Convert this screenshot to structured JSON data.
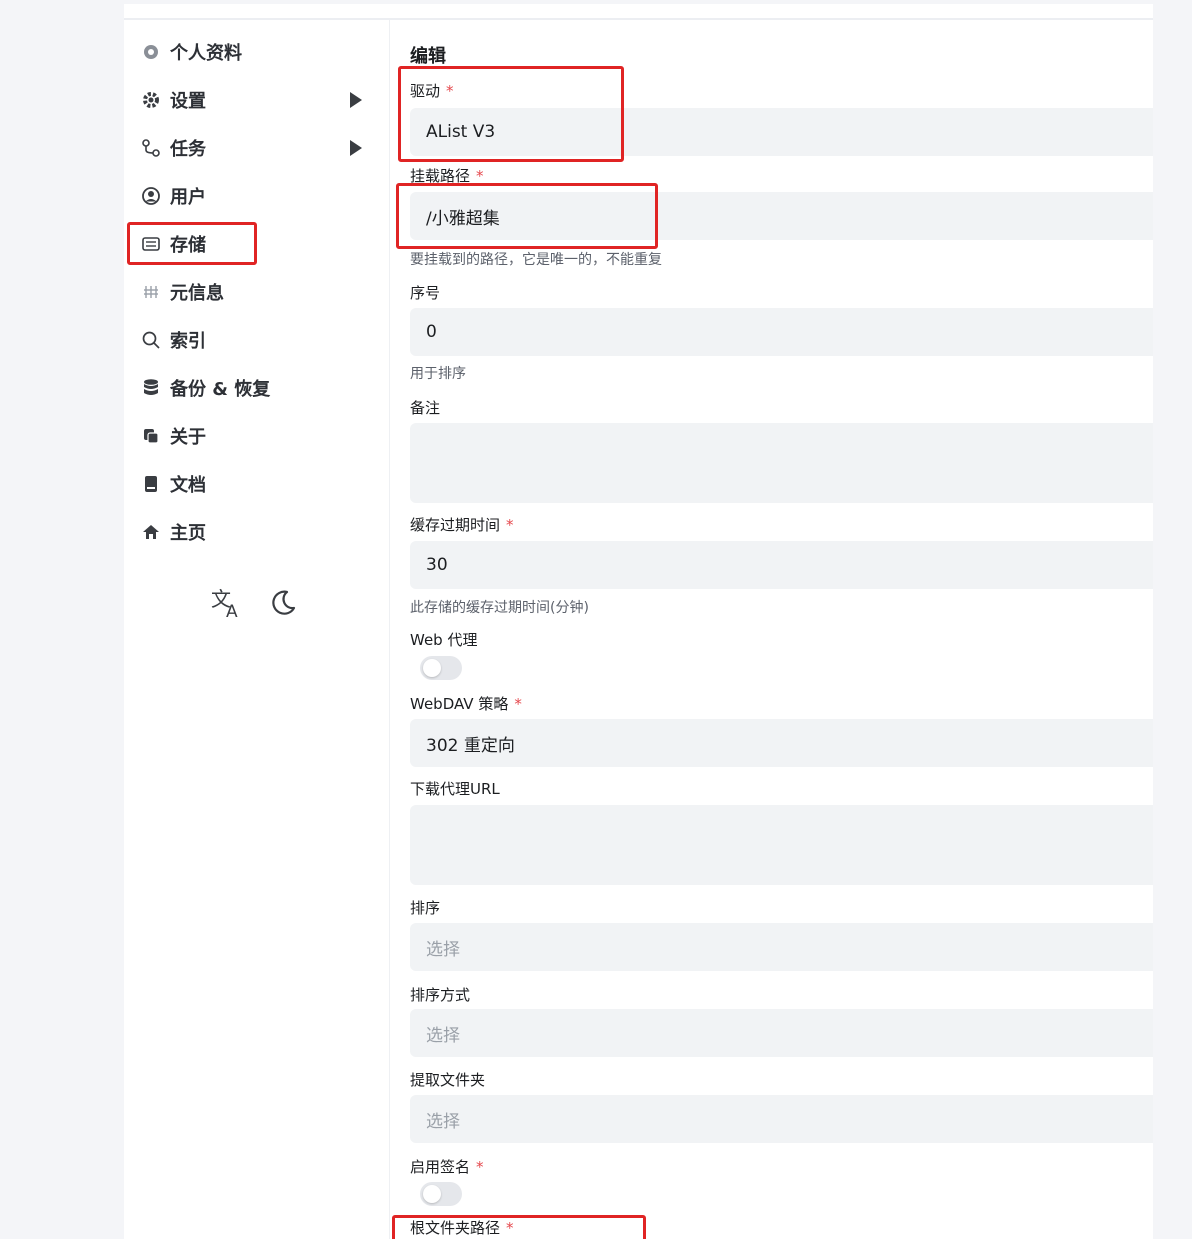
{
  "sidebar": {
    "items": [
      {
        "label": "个人资料",
        "icon": "user-settings-icon",
        "active": false,
        "has_arrow": false
      },
      {
        "label": "设置",
        "icon": "gear-icon",
        "active": false,
        "has_arrow": true
      },
      {
        "label": "任务",
        "icon": "task-flow-icon",
        "active": false,
        "has_arrow": true
      },
      {
        "label": "用户",
        "icon": "user-circle-icon",
        "active": false,
        "has_arrow": false
      },
      {
        "label": "存储",
        "icon": "storage-icon",
        "active": true,
        "has_arrow": false
      },
      {
        "label": "元信息",
        "icon": "metadata-icon",
        "active": false,
        "has_arrow": false
      },
      {
        "label": "索引",
        "icon": "search-icon",
        "active": false,
        "has_arrow": false
      },
      {
        "label": "备份 & 恢复",
        "icon": "database-icon",
        "active": false,
        "has_arrow": false
      },
      {
        "label": "关于",
        "icon": "copy-icon",
        "active": false,
        "has_arrow": false
      },
      {
        "label": "文档",
        "icon": "book-icon",
        "active": false,
        "has_arrow": false
      },
      {
        "label": "主页",
        "icon": "home-icon",
        "active": false,
        "has_arrow": false
      }
    ],
    "tools": [
      "translate-icon",
      "moon-icon"
    ]
  },
  "form": {
    "title": "编辑",
    "driver": {
      "label": "驱动",
      "value": "AList V3"
    },
    "mount_path": {
      "label": "挂载路径",
      "value": "/小雅超集",
      "hint": "要挂载到的路径，它是唯一的，不能重复"
    },
    "order": {
      "label": "序号",
      "value": "0",
      "hint": "用于排序"
    },
    "remark": {
      "label": "备注",
      "value": ""
    },
    "cache_expiration": {
      "label": "缓存过期时间",
      "value": "30",
      "hint": "此存储的缓存过期时间(分钟)"
    },
    "web_proxy": {
      "label": "Web 代理",
      "enabled": false
    },
    "webdav_policy": {
      "label": "WebDAV 策略",
      "value": "302 重定向"
    },
    "download_proxy_url": {
      "label": "下载代理URL",
      "value": ""
    },
    "order_by": {
      "label": "排序",
      "placeholder": "选择"
    },
    "order_direction": {
      "label": "排序方式",
      "placeholder": "选择"
    },
    "extract_folder": {
      "label": "提取文件夹",
      "placeholder": "选择"
    },
    "enable_sign": {
      "label": "启用签名",
      "enabled": false
    },
    "root_folder_path": {
      "label": "根文件夹路径"
    },
    "required_mark": "*"
  },
  "colors": {
    "accent_red": "#e02424",
    "required": "#e5484d",
    "field_bg": "#f1f3f5"
  }
}
